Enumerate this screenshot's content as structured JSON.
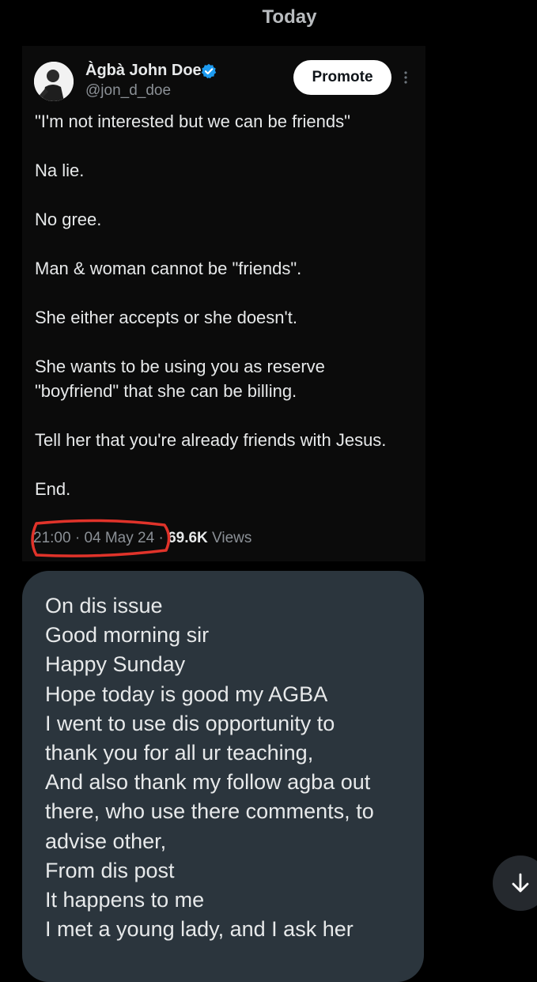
{
  "header": {
    "date": "Today"
  },
  "tweet": {
    "author_name": "Àgbà John Doe",
    "author_handle": "@jon_d_doe",
    "promote_label": "Promote",
    "paragraphs": [
      "\"I'm not interested but we can be friends\"",
      "Na lie.",
      "No gree.",
      "Man & woman cannot be \"friends\".",
      "She either accepts or she doesn't.",
      "She wants to be using you as reserve \"boyfriend\" that she can be billing.",
      "Tell her that you're already friends with Jesus.",
      "End."
    ],
    "time": "21:00",
    "separator": "·",
    "date": "04 May 24",
    "views_count": "69.6K",
    "views_label": "Views"
  },
  "reply": {
    "lines": [
      "On dis issue",
      "Good morning sir",
      "Happy Sunday",
      "Hope today is good my AGBA",
      "I went to use dis opportunity to",
      "thank you for all ur teaching,",
      "And also thank my follow agba out",
      "there, who use there comments, to",
      "advise other,",
      "From dis post",
      "It happens to me",
      "I met a young lady, and I ask her"
    ]
  },
  "icons": {
    "verified": "verified-badge-icon",
    "more": "more-vertical-icon",
    "scroll": "arrow-down-icon"
  },
  "colors": {
    "background": "#000000",
    "bubble": "#2b353d",
    "verified": "#1d9bf0",
    "annotation": "#e0332a",
    "muted_text": "#8b9096"
  }
}
